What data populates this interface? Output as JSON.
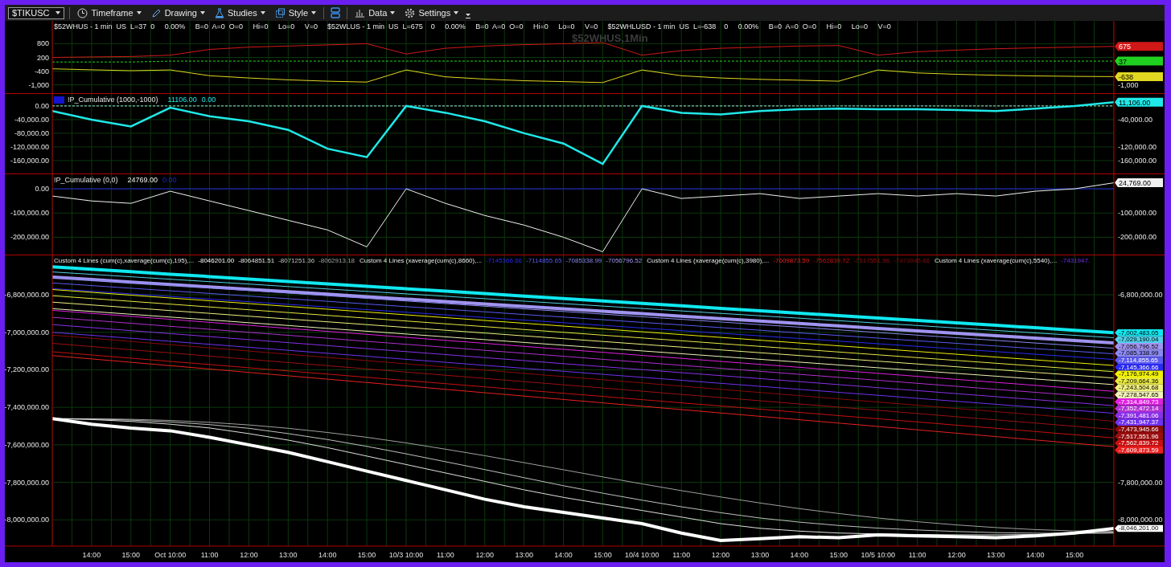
{
  "toolbar": {
    "symbol": "$TIKUSC",
    "menus_left": [
      {
        "label": "Timeframe"
      },
      {
        "label": "Drawing"
      },
      {
        "label": "Studies"
      },
      {
        "label": "Style"
      }
    ],
    "menus_right": [
      {
        "label": "Data"
      },
      {
        "label": "Settings"
      }
    ]
  },
  "panes": [
    {
      "legend": [
        "$52WHUS - 1 min  US  L=37  0     0.00%     B=0  A=0  O=0     Hi=0     Lo=0     V=0",
        "$52WLUS - 1 min  US  L=675    0     0.00%     B=0  A=0  O=0     Hi=0     Lo=0     V=0",
        "$52WHLUSD - 1 min  US  L=-638    0     0.00%     B=0  A=0  O=0     Hi=0     Lo=0     V=0"
      ],
      "watermark": "$52WHUS,1Min",
      "right_ticks": [
        "-1,000"
      ],
      "price_tags": [
        "675",
        "37",
        "-638"
      ],
      "chart_data": {
        "type": "line",
        "grid": true,
        "ylim": [
          -1400,
          1800
        ],
        "categories": [
          null,
          null,
          null,
          null,
          null,
          null,
          null,
          null,
          null,
          null,
          null,
          null,
          null,
          null,
          null,
          null,
          null,
          null,
          null,
          null,
          null,
          null,
          null,
          null,
          null,
          null,
          null,
          null
        ],
        "yticks": [
          {
            "value": 800,
            "label": "800"
          },
          {
            "value": 200,
            "label": "200"
          },
          {
            "value": -400,
            "label": "-400"
          },
          {
            "value": -1000,
            "label": "-1,000"
          }
        ],
        "series": [
          {
            "color": "#d01818",
            "values": [
              200,
              220,
              240,
              300,
              550,
              650,
              700,
              750,
              800,
              350,
              600,
              700,
              760,
              800,
              850,
              300,
              500,
              600,
              650,
              700,
              720,
              300,
              450,
              520,
              580,
              620,
              650,
              680
            ]
          },
          {
            "color": "#20d020",
            "line_style": "dashed",
            "values": [
              0,
              0,
              0,
              40,
              40,
              40,
              40,
              40,
              40,
              40,
              40,
              40,
              40,
              40,
              40,
              40,
              40,
              40,
              40,
              40,
              40,
              40,
              40,
              40,
              40,
              40,
              40,
              40
            ]
          },
          {
            "color": "#e0d820",
            "values": [
              -300,
              -340,
              -380,
              -350,
              -600,
              -700,
              -780,
              -840,
              -880,
              -350,
              -650,
              -750,
              -820,
              -860,
              -900,
              -350,
              -600,
              -700,
              -760,
              -800,
              -840,
              -350,
              -480,
              -540,
              -580,
              -610,
              -630,
              -640
            ]
          }
        ]
      }
    },
    {
      "badge": true,
      "title": "!P_Cumulative (1000,-1000)",
      "legend_values": [
        "11106.00",
        "0.00"
      ],
      "right_ticks": [
        "-40,000.00",
        "-120,000.00",
        "-160,000.00"
      ],
      "price_tags": [
        "11,106.00"
      ],
      "chart_data": {
        "type": "line",
        "grid": true,
        "ylim": [
          -200000,
          35000
        ],
        "categories": [
          null,
          null,
          null,
          null,
          null,
          null,
          null,
          null,
          null,
          null,
          null,
          null,
          null,
          null,
          null,
          null,
          null,
          null,
          null,
          null,
          null,
          null,
          null,
          null,
          null,
          null,
          null,
          null
        ],
        "yticks": [
          {
            "value": 0,
            "label": "0.00"
          },
          {
            "value": -40000,
            "label": "-40,000.00"
          },
          {
            "value": -80000,
            "label": "-80,000.00"
          },
          {
            "value": -120000,
            "label": "-120,000.00"
          },
          {
            "value": -160000,
            "label": "-160,000.00"
          }
        ],
        "series": [
          {
            "color": "#9fe0e0",
            "line_style": "dashed",
            "values": [
              0,
              0,
              0,
              0,
              0,
              0,
              0,
              0,
              0,
              0,
              0,
              0,
              0,
              0,
              0,
              0,
              0,
              0,
              0,
              0,
              0,
              0,
              0,
              0,
              0,
              0,
              0,
              0
            ]
          },
          {
            "color": "#20e8e8",
            "values": [
              -15000,
              -40000,
              -60000,
              -5000,
              -30000,
              -45000,
              -70000,
              -125000,
              -150000,
              0,
              -20000,
              -45000,
              -80000,
              -110000,
              -170000,
              0,
              -20000,
              -25000,
              -15000,
              -10000,
              -8000,
              -10000,
              -10000,
              -12000,
              -15000,
              -8000,
              0,
              11000
            ]
          }
        ]
      }
    },
    {
      "badge": false,
      "title": "!P_Cumulative (0,0)",
      "legend_values": [
        "24769.00",
        "0.00"
      ],
      "right_ticks": [
        "-100,000.00",
        "-200,000.00"
      ],
      "price_tags": [
        "24,769.00"
      ],
      "chart_data": {
        "type": "line",
        "grid": true,
        "ylim": [
          -275000,
          60000
        ],
        "categories": [
          null,
          null,
          null,
          null,
          null,
          null,
          null,
          null,
          null,
          null,
          null,
          null,
          null,
          null,
          null,
          null,
          null,
          null,
          null,
          null,
          null,
          null,
          null,
          null,
          null,
          null,
          null,
          null
        ],
        "yticks": [
          {
            "value": 0,
            "label": "0.00"
          },
          {
            "value": -100000,
            "label": "-100,000.00"
          },
          {
            "value": -200000,
            "label": "-200,000.00"
          }
        ],
        "series": [
          {
            "color": "#2020e0",
            "values": [
              0,
              0,
              0,
              0,
              0,
              0,
              0,
              0,
              0,
              0,
              0,
              0,
              0,
              0,
              0,
              0,
              0,
              0,
              0,
              0,
              0,
              0,
              0,
              0,
              0,
              0,
              0,
              0
            ]
          },
          {
            "color": "#f0f0f0",
            "values": [
              -30000,
              -50000,
              -60000,
              -10000,
              -50000,
              -90000,
              -130000,
              -170000,
              -240000,
              0,
              -60000,
              -110000,
              -150000,
              -200000,
              -260000,
              0,
              -40000,
              -30000,
              -20000,
              -40000,
              -30000,
              -20000,
              -30000,
              -20000,
              -30000,
              -10000,
              0,
              25000
            ]
          }
        ]
      }
    },
    {
      "groups": [
        {
          "title": "Custom 4 Lines (cum(c),xaverage(cum(c),195),...",
          "values": [
            "-8046201.00",
            "-8064851.51",
            "-8071251.36",
            "-8062913.18"
          ]
        },
        {
          "title": "Custom 4 Lines (xaverage(cum(c),8660),...",
          "values": [
            "-7145366.66",
            "-7114855.65",
            "-7085338.99",
            "-7056796.52"
          ]
        },
        {
          "title": "Custom 4 Lines (xaverage(cum(c),3980),...",
          "values": [
            "-7609873.59",
            "-7562839.72",
            "-7517551.96",
            "-7473945.66"
          ]
        },
        {
          "title": "Custom 4 Lines (xaverage(cum(c),5540),...",
          "values": [
            "-7431947."
          ]
        }
      ],
      "right_ticks": [
        "-6,800,000.00",
        "-7,800,000.00",
        "-8,000,000.00"
      ],
      "price_tags": [
        "-7,002,483.05",
        "-7,029,190.04",
        "-7,056,796.52",
        "-7,085,338.99",
        "-7,114,855.65",
        "-7,145,366.66",
        "-7,176,974.49",
        "-7,209,664.36",
        "-7,243,504.68",
        "-7,278,547.65",
        "-7,314,849.73",
        "-7,352,472.14",
        "-7,391,481.06",
        "-7,431,947.37",
        "-7,473,945.66",
        "-7,517,551.96",
        "-7,562,839.72",
        "-7,609,873.59",
        "-8,046,201.00"
      ],
      "chart_data": {
        "type": "line",
        "grid": true,
        "ylim": [
          -8140000,
          -6590000
        ],
        "categories": [
          null,
          "14:00",
          "15:00",
          "Oct 10:00",
          "11:00",
          "12:00",
          "13:00",
          "14:00",
          "15:00",
          "10/3 10:00",
          "11:00",
          "12:00",
          "13:00",
          "14:00",
          "15:00",
          "10/4 10:00",
          "11:00",
          "12:00",
          "13:00",
          "14:00",
          "15:00",
          "10/5 10:00",
          "11:00",
          "12:00",
          "13:00",
          "14:00",
          "15:00",
          null
        ],
        "yticks": [
          {
            "value": -6800000,
            "label": "-6,800,000.00"
          },
          {
            "value": -7000000,
            "label": "-7,000,000.00"
          },
          {
            "value": -7200000,
            "label": "-7,200,000.00"
          },
          {
            "value": -7400000,
            "label": "-7,400,000.00"
          },
          {
            "value": -7600000,
            "label": "-7,600,000.00"
          },
          {
            "value": -7800000,
            "label": "-7,800,000.00"
          },
          {
            "value": -8000000,
            "label": "-8,000,000.00"
          }
        ],
        "series": [
          {
            "color": "#10e8f0",
            "values": [
              -6651000,
              -6664000,
              -6677000,
              -6690000,
              -6703000,
              -6716000,
              -6729000,
              -6742000,
              -6755000,
              -6768000,
              -6781000,
              -6794000,
              -6807000,
              -6820000,
              -6833000,
              -6846000,
              -6859000,
              -6872000,
              -6885000,
              -6898000,
              -6911000,
              -6924000,
              -6937000,
              -6950000,
              -6963000,
              -6976000,
              -6989000,
              -7002000
            ]
          },
          {
            "color": "#50d0e8",
            "values": [
              -6678000,
              -6691000,
              -6704000,
              -6717000,
              -6730000,
              -6743000,
              -6756000,
              -6769000,
              -6782000,
              -6795000,
              -6808000,
              -6821000,
              -6834000,
              -6847000,
              -6860000,
              -6873000,
              -6886000,
              -6899000,
              -6912000,
              -6925000,
              -6938000,
              -6951000,
              -6964000,
              -6977000,
              -6990000,
              -7003000,
              -7016000,
              -7029000
            ]
          },
          {
            "color": "#a094f0",
            "values": [
              -6706000,
              -6719000,
              -6732000,
              -6745000,
              -6758000,
              -6771000,
              -6784000,
              -6797000,
              -6810000,
              -6823000,
              -6836000,
              -6849000,
              -6862000,
              -6875000,
              -6888000,
              -6901000,
              -6914000,
              -6927000,
              -6940000,
              -6953000,
              -6966000,
              -6979000,
              -6992000,
              -7005000,
              -7018000,
              -7031000,
              -7044000,
              -7057000
            ]
          },
          {
            "color": "#8a88f0",
            "values": [
              -6707000,
              -6721000,
              -6735000,
              -6749000,
              -6763000,
              -6777000,
              -6791000,
              -6805000,
              -6819000,
              -6833000,
              -6847000,
              -6861000,
              -6875000,
              -6889000,
              -6903000,
              -6917000,
              -6931000,
              -6945000,
              -6959000,
              -6973000,
              -6987000,
              -7001000,
              -7015000,
              -7029000,
              -7043000,
              -7057000,
              -7071000,
              -7085000
            ]
          },
          {
            "color": "#5a5af0",
            "values": [
              -6737000,
              -6751000,
              -6765000,
              -6779000,
              -6793000,
              -6807000,
              -6821000,
              -6835000,
              -6849000,
              -6863000,
              -6877000,
              -6891000,
              -6905000,
              -6919000,
              -6933000,
              -6947000,
              -6961000,
              -6975000,
              -6989000,
              -7003000,
              -7017000,
              -7031000,
              -7045000,
              -7059000,
              -7073000,
              -7087000,
              -7101000,
              -7115000
            ]
          },
          {
            "color": "#2a2af0",
            "values": [
              -6767000,
              -6781000,
              -6795000,
              -6809000,
              -6823000,
              -6837000,
              -6851000,
              -6865000,
              -6879000,
              -6893000,
              -6907000,
              -6921000,
              -6935000,
              -6949000,
              -6963000,
              -6977000,
              -6991000,
              -7005000,
              -7019000,
              -7033000,
              -7047000,
              -7061000,
              -7075000,
              -7089000,
              -7103000,
              -7117000,
              -7131000,
              -7145000
            ]
          },
          {
            "color": "#f0f000",
            "values": [
              -6772000,
              -6787000,
              -6802000,
              -6817000,
              -6832000,
              -6847000,
              -6862000,
              -6877000,
              -6892000,
              -6907000,
              -6922000,
              -6937000,
              -6952000,
              -6967000,
              -6982000,
              -6997000,
              -7012000,
              -7027000,
              -7042000,
              -7057000,
              -7072000,
              -7087000,
              -7102000,
              -7117000,
              -7132000,
              -7147000,
              -7162000,
              -7177000
            ]
          },
          {
            "color": "#e8e840",
            "values": [
              -6805000,
              -6820000,
              -6835000,
              -6850000,
              -6865000,
              -6880000,
              -6895000,
              -6910000,
              -6925000,
              -6940000,
              -6955000,
              -6970000,
              -6985000,
              -7000000,
              -7015000,
              -7030000,
              -7045000,
              -7060000,
              -7075000,
              -7090000,
              -7105000,
              -7120000,
              -7135000,
              -7150000,
              -7165000,
              -7180000,
              -7195000,
              -7210000
            ]
          },
          {
            "color": "#f0f080",
            "values": [
              -6839000,
              -6854000,
              -6869000,
              -6884000,
              -6899000,
              -6914000,
              -6929000,
              -6944000,
              -6959000,
              -6974000,
              -6989000,
              -7004000,
              -7019000,
              -7034000,
              -7049000,
              -7064000,
              -7079000,
              -7094000,
              -7109000,
              -7124000,
              -7139000,
              -7154000,
              -7169000,
              -7184000,
              -7199000,
              -7214000,
              -7229000,
              -7244000
            ]
          },
          {
            "color": "#f0f0b8",
            "values": [
              -6874000,
              -6889000,
              -6904000,
              -6919000,
              -6934000,
              -6949000,
              -6964000,
              -6979000,
              -6994000,
              -7009000,
              -7024000,
              -7039000,
              -7054000,
              -7069000,
              -7084000,
              -7099000,
              -7114000,
              -7129000,
              -7144000,
              -7159000,
              -7174000,
              -7189000,
              -7204000,
              -7219000,
              -7234000,
              -7249000,
              -7264000,
              -7279000
            ]
          },
          {
            "color": "#e020e0",
            "values": [
              -6883000,
              -6899000,
              -6915000,
              -6931000,
              -6947000,
              -6963000,
              -6979000,
              -6995000,
              -7011000,
              -7027000,
              -7043000,
              -7059000,
              -7075000,
              -7091000,
              -7107000,
              -7123000,
              -7139000,
              -7155000,
              -7171000,
              -7187000,
              -7203000,
              -7219000,
              -7235000,
              -7251000,
              -7267000,
              -7283000,
              -7299000,
              -7315000
            ]
          },
          {
            "color": "#b030d0",
            "values": [
              -6920000,
              -6936000,
              -6952000,
              -6968000,
              -6984000,
              -7000000,
              -7016000,
              -7032000,
              -7048000,
              -7064000,
              -7080000,
              -7096000,
              -7112000,
              -7128000,
              -7144000,
              -7160000,
              -7176000,
              -7192000,
              -7208000,
              -7224000,
              -7240000,
              -7256000,
              -7272000,
              -7288000,
              -7304000,
              -7320000,
              -7336000,
              -7352000
            ]
          },
          {
            "color": "#8a30e8",
            "values": [
              -6959000,
              -6975000,
              -6991000,
              -7007000,
              -7023000,
              -7039000,
              -7055000,
              -7071000,
              -7087000,
              -7103000,
              -7119000,
              -7135000,
              -7151000,
              -7167000,
              -7183000,
              -7199000,
              -7215000,
              -7231000,
              -7247000,
              -7263000,
              -7279000,
              -7295000,
              -7311000,
              -7327000,
              -7343000,
              -7359000,
              -7375000,
              -7391000
            ]
          },
          {
            "color": "#7030f0",
            "values": [
              -7000000,
              -7016000,
              -7032000,
              -7048000,
              -7064000,
              -7080000,
              -7096000,
              -7112000,
              -7128000,
              -7144000,
              -7160000,
              -7176000,
              -7192000,
              -7208000,
              -7224000,
              -7240000,
              -7256000,
              -7272000,
              -7288000,
              -7304000,
              -7320000,
              -7336000,
              -7352000,
              -7368000,
              -7384000,
              -7400000,
              -7416000,
              -7432000
            ]
          },
          {
            "color": "#8a0a0a",
            "values": [
              -7015000,
              -7032000,
              -7049000,
              -7066000,
              -7083000,
              -7100000,
              -7117000,
              -7134000,
              -7151000,
              -7168000,
              -7185000,
              -7202000,
              -7219000,
              -7236000,
              -7253000,
              -7270000,
              -7287000,
              -7304000,
              -7321000,
              -7338000,
              -7355000,
              -7372000,
              -7389000,
              -7406000,
              -7423000,
              -7440000,
              -7457000,
              -7474000
            ]
          },
          {
            "color": "#9a1010",
            "values": [
              -7059000,
              -7076000,
              -7093000,
              -7110000,
              -7127000,
              -7144000,
              -7161000,
              -7178000,
              -7195000,
              -7212000,
              -7229000,
              -7246000,
              -7263000,
              -7280000,
              -7297000,
              -7314000,
              -7331000,
              -7348000,
              -7365000,
              -7382000,
              -7399000,
              -7416000,
              -7433000,
              -7450000,
              -7467000,
              -7484000,
              -7501000,
              -7518000
            ]
          },
          {
            "color": "#c81010",
            "values": [
              -7104000,
              -7121000,
              -7138000,
              -7155000,
              -7172000,
              -7189000,
              -7206000,
              -7223000,
              -7240000,
              -7257000,
              -7274000,
              -7291000,
              -7308000,
              -7325000,
              -7342000,
              -7359000,
              -7376000,
              -7393000,
              -7410000,
              -7427000,
              -7444000,
              -7461000,
              -7478000,
              -7495000,
              -7512000,
              -7529000,
              -7546000,
              -7563000
            ]
          },
          {
            "color": "#e82020",
            "values": [
              -7124000,
              -7142000,
              -7160000,
              -7178000,
              -7196000,
              -7214000,
              -7232000,
              -7250000,
              -7268000,
              -7286000,
              -7304000,
              -7322000,
              -7340000,
              -7358000,
              -7376000,
              -7394000,
              -7412000,
              -7430000,
              -7448000,
              -7466000,
              -7484000,
              -7502000,
              -7520000,
              -7538000,
              -7556000,
              -7574000,
              -7592000,
              -7610000
            ]
          },
          {
            "color": "#a0a0a0",
            "values": [
              -7460000,
              -7461000,
              -7464000,
              -7470000,
              -7480000,
              -7494000,
              -7512000,
              -7534000,
              -7560000,
              -7590000,
              -7623000,
              -7658000,
              -7695000,
              -7733000,
              -7771000,
              -7808000,
              -7844000,
              -7878000,
              -7910000,
              -7940000,
              -7966000,
              -7990000,
              -8010000,
              -8027000,
              -8041000,
              -8052000,
              -8059000,
              -8063000
            ]
          },
          {
            "color": "#c0c0c0",
            "values": [
              -7460000,
              -7462000,
              -7468000,
              -7478000,
              -7492000,
              -7512000,
              -7540000,
              -7572000,
              -7608000,
              -7648000,
              -7690000,
              -7732000,
              -7775000,
              -7818000,
              -7858000,
              -7895000,
              -7930000,
              -7962000,
              -7990000,
              -8012000,
              -8030000,
              -8044000,
              -8054000,
              -8062000,
              -8068000,
              -8071000,
              -8072000,
              -8071000
            ]
          },
          {
            "color": "#e0e0e0",
            "values": [
              -7460000,
              -7465000,
              -7475000,
              -7490000,
              -7510000,
              -7540000,
              -7575000,
              -7615000,
              -7660000,
              -7705000,
              -7750000,
              -7795000,
              -7840000,
              -7880000,
              -7915000,
              -7950000,
              -7985000,
              -8020000,
              -8045000,
              -8060000,
              -8070000,
              -8075000,
              -8078000,
              -8080000,
              -8080000,
              -8078000,
              -8072000,
              -8065000
            ]
          },
          {
            "color": "#ffffff",
            "values": [
              -7460000,
              -7490000,
              -7510000,
              -7525000,
              -7560000,
              -7600000,
              -7640000,
              -7690000,
              -7740000,
              -7790000,
              -7840000,
              -7890000,
              -7930000,
              -7960000,
              -7990000,
              -8020000,
              -8070000,
              -8110000,
              -8100000,
              -8090000,
              -8095000,
              -8080000,
              -8085000,
              -8090000,
              -8095000,
              -8085000,
              -8070000,
              -8046000
            ]
          }
        ]
      }
    }
  ]
}
